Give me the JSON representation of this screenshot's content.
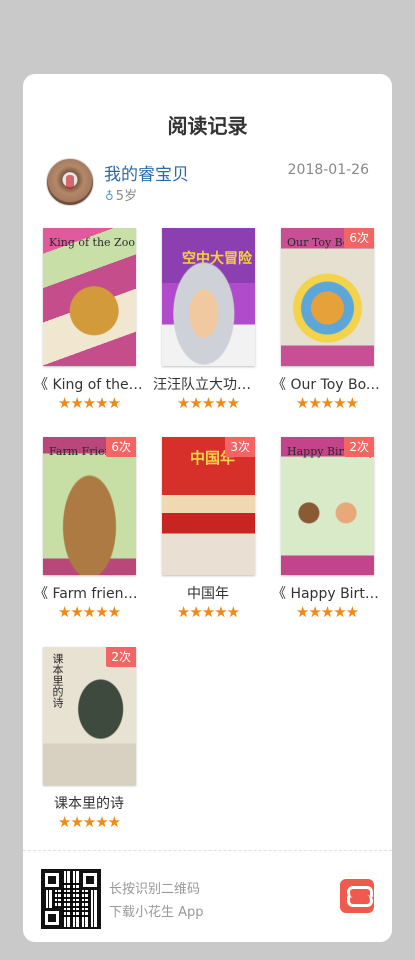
{
  "header": {
    "title": "阅读记录"
  },
  "profile": {
    "name": "我的睿宝贝",
    "age_icon": "person-icon",
    "age": "5岁",
    "date": "2018-01-26"
  },
  "books": [
    {
      "name": "《 King of the Zoo》",
      "cover_title": "King of the Zoo",
      "badge": "",
      "stars": "★★★★★",
      "rating": 5,
      "colors": [
        "#cf3f86",
        "#6aa94b"
      ]
    },
    {
      "name": "汪汪队立大功：空中大冒险",
      "cover_title": "空中大冒险",
      "badge": "",
      "stars": "★★★★★",
      "rating": 5,
      "colors": [
        "#8e3fb1",
        "#eee"
      ]
    },
    {
      "name": "《 Our Toy Box》",
      "cover_title": "Our Toy Box",
      "badge": "6次",
      "stars": "★★★★★",
      "rating": 5,
      "colors": [
        "#c94b8c",
        "#e8b44a"
      ]
    },
    {
      "name": "《 Farm friends》",
      "cover_title": "Farm Friends",
      "badge": "6次",
      "stars": "★★★★★",
      "rating": 5,
      "colors": [
        "#b8466f",
        "#8bbf5a"
      ]
    },
    {
      "name": "中国年",
      "cover_title": "中国年",
      "badge": "3次",
      "stars": "★★★★★",
      "rating": 5,
      "colors": [
        "#d52a26",
        "#f5c33a"
      ]
    },
    {
      "name": "《 Happy Birthday》",
      "cover_title": "Happy Birthday",
      "badge": "2次",
      "stars": "★★★★★",
      "rating": 5,
      "colors": [
        "#c3448a",
        "#7bbf6a"
      ]
    },
    {
      "name": "课本里的诗",
      "cover_title": "课本里的诗",
      "badge": "2次",
      "stars": "★★★★★",
      "rating": 5,
      "colors": [
        "#ece6d8",
        "#4f5a4a"
      ]
    }
  ],
  "footer": {
    "qr_line1": "长按识别二维码",
    "qr_line2": "下载小花生 App",
    "logo_icon": "xiaohuasheng-logo-icon"
  }
}
